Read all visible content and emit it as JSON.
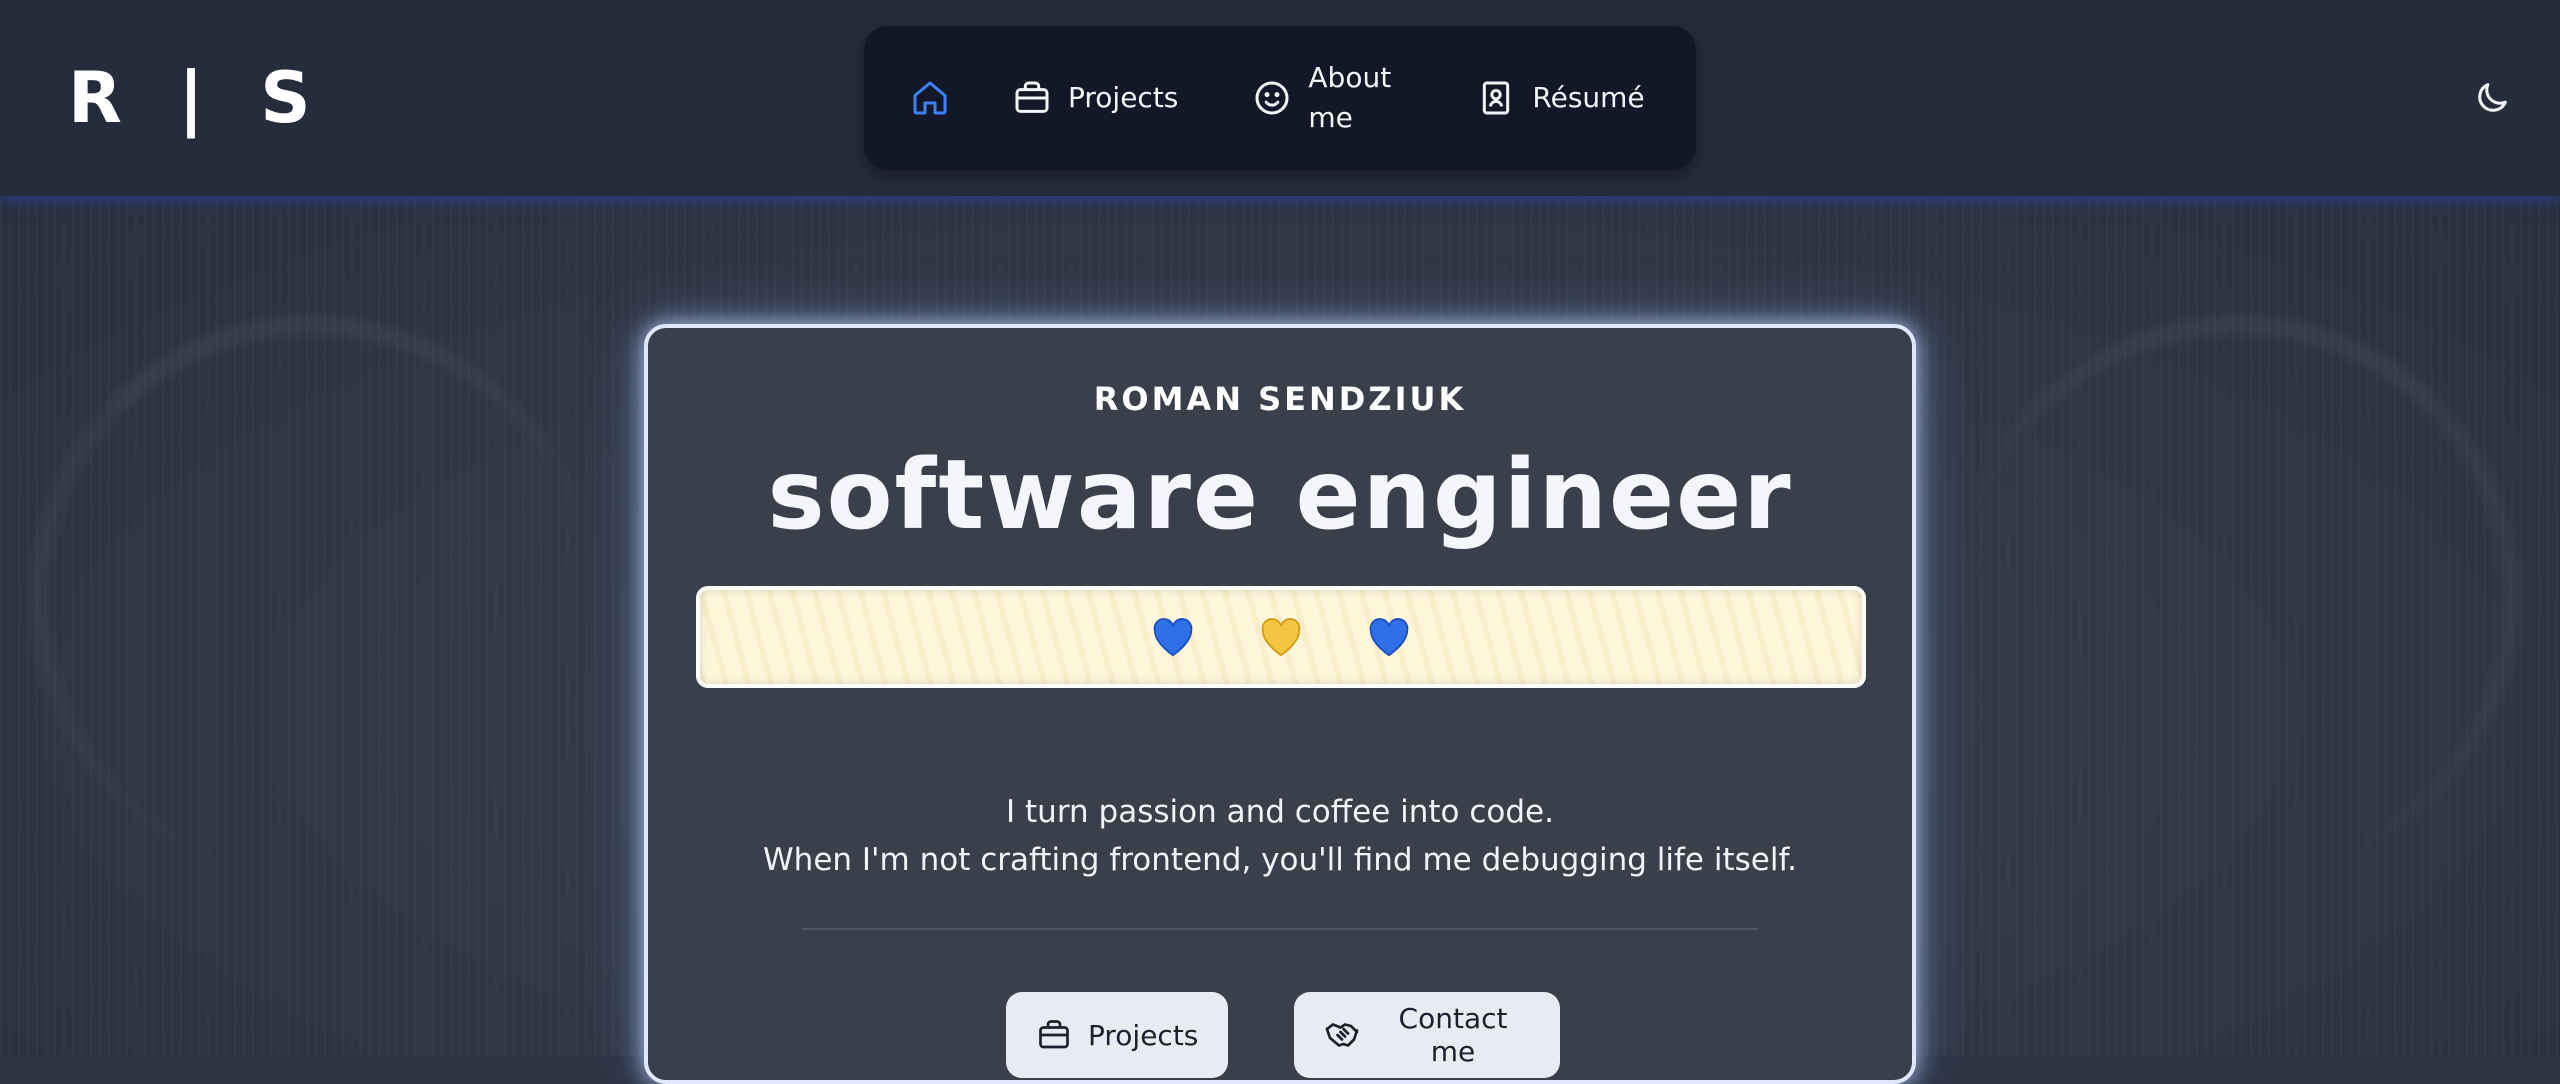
{
  "header": {
    "logo": "R | S",
    "nav": {
      "items": [
        {
          "label": "",
          "icon": "home-icon",
          "active": true
        },
        {
          "label": "Projects",
          "icon": "briefcase-icon"
        },
        {
          "label": "About me",
          "icon": "smile-icon"
        },
        {
          "label": "Résumé",
          "icon": "contact-book-icon"
        }
      ]
    },
    "theme_toggle_icon": "moon-icon"
  },
  "hero": {
    "name": "ROMAN SENDZIUK",
    "title": "software engineer",
    "hearts": [
      "💙",
      "💛",
      "💙"
    ],
    "tagline_line1": "I turn passion and coffee into code.",
    "tagline_line2": "When I'm not crafting frontend, you'll find me debugging life itself.",
    "buttons": {
      "projects": "Projects",
      "contact": "Contact me"
    }
  },
  "colors": {
    "accent": "#3b82f6",
    "header_bg": "#252c3b",
    "nav_bg": "#121827",
    "card_bg": "#3a3f4c",
    "button_bg": "#e7ebf2"
  }
}
